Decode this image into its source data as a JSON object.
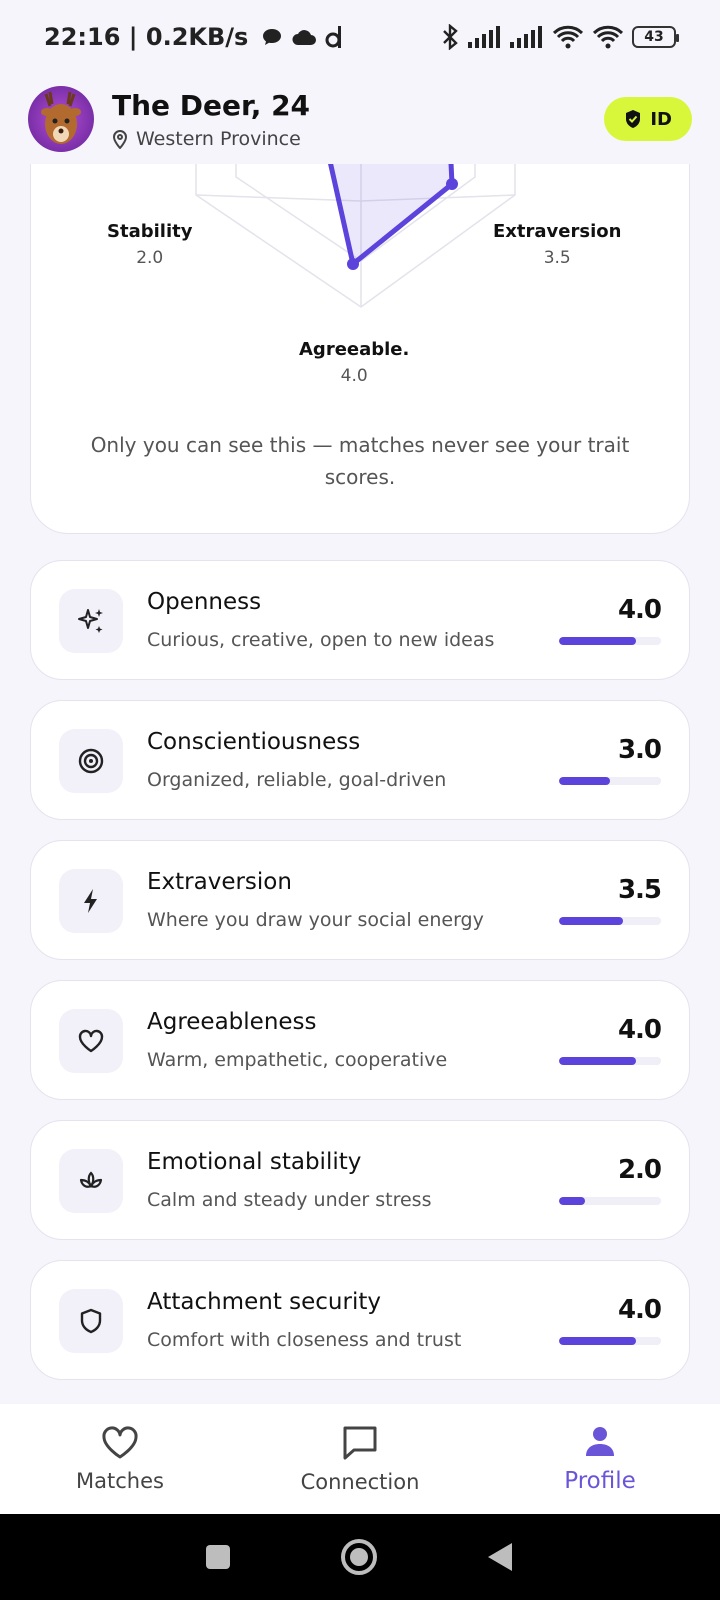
{
  "status_bar": {
    "time_speed": "22:16 | 0.2KB/s",
    "battery": "43"
  },
  "header": {
    "name": "The Deer, 24",
    "location": "Western Province",
    "badge": "ID"
  },
  "radar": {
    "labels": {
      "stability": {
        "name": "Stability",
        "value": "2.0"
      },
      "extraversion": {
        "name": "Extraversion",
        "value": "3.5"
      },
      "agreeable": {
        "name": "Agreeable.",
        "value": "4.0"
      }
    },
    "note": "Only you can see this — matches never see your trait scores."
  },
  "traits": [
    {
      "title": "Openness",
      "desc": "Curious, creative, open to new ideas",
      "score": "4.0",
      "icon": "sparkles-icon",
      "fraction": 0.75
    },
    {
      "title": "Conscientiousness",
      "desc": "Organized, reliable, goal-driven",
      "score": "3.0",
      "icon": "target-icon",
      "fraction": 0.5
    },
    {
      "title": "Extraversion",
      "desc": "Where you draw your social energy",
      "score": "3.5",
      "icon": "lightning-icon",
      "fraction": 0.625
    },
    {
      "title": "Agreeableness",
      "desc": "Warm, empathetic, cooperative",
      "score": "4.0",
      "icon": "heart-icon",
      "fraction": 0.75
    },
    {
      "title": "Emotional stability",
      "desc": "Calm and steady under stress",
      "score": "2.0",
      "icon": "lotus-icon",
      "fraction": 0.25
    },
    {
      "title": "Attachment security",
      "desc": "Comfort with closeness and trust",
      "score": "4.0",
      "icon": "shield-icon",
      "fraction": 0.75
    }
  ],
  "nav": {
    "matches": "Matches",
    "connection": "Connection",
    "profile": "Profile"
  },
  "colors": {
    "accent": "#5b43dc",
    "badge": "#d8f63a"
  }
}
